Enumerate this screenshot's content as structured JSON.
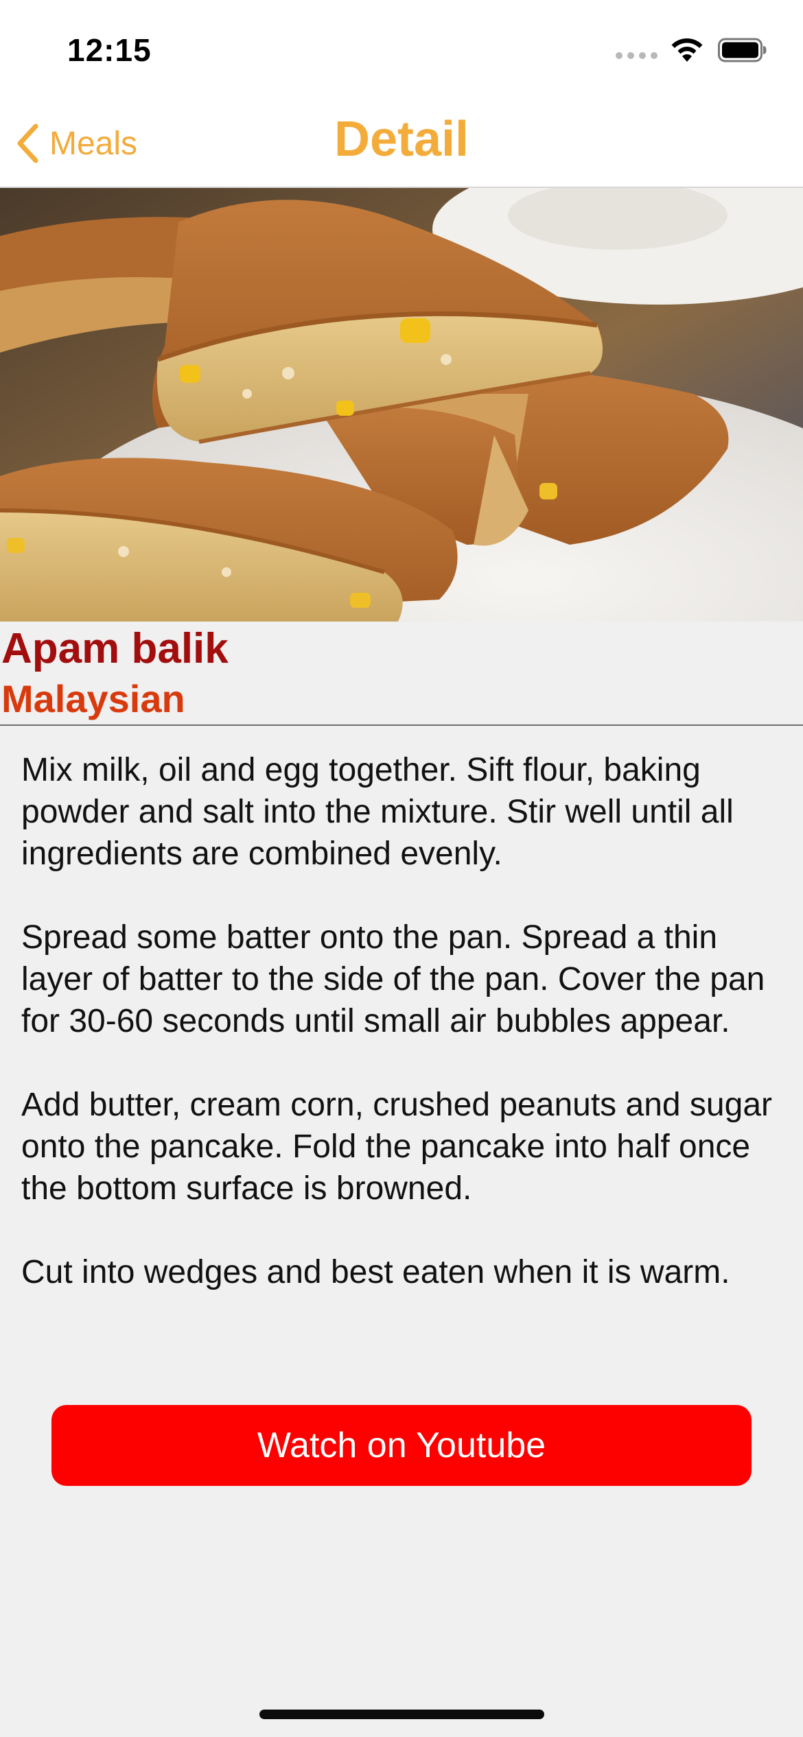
{
  "status_bar": {
    "time": "12:15"
  },
  "nav": {
    "back_label": "Meals",
    "title": "Detail",
    "accent_color": "#f3ab3a"
  },
  "hero_image": {
    "subject": "apam balik pancake wedges on a white plate"
  },
  "meal": {
    "name": "Apam balik",
    "area": "Malaysian",
    "name_color": "#a20d0d",
    "area_color": "#d83a0e",
    "instructions": [
      "Mix milk, oil and egg together. Sift flour, baking powder and salt into the mixture. Stir well until all ingredients are combined evenly.",
      "Spread some batter onto the pan. Spread a thin layer of batter to the side of the pan. Cover the pan for 30-60 seconds until small air bubbles appear.",
      "Add butter, cream corn, crushed peanuts and sugar onto the pancake. Fold the pancake into half once the bottom surface is browned.",
      "Cut into wedges and best eaten when it is warm."
    ]
  },
  "youtube_button": {
    "label": "Watch on Youtube",
    "color": "#fd0000"
  },
  "icons": {
    "back": "chevron-left-icon",
    "wifi": "wifi-icon",
    "battery": "battery-icon",
    "cellular": "cellular-signal-icon"
  }
}
